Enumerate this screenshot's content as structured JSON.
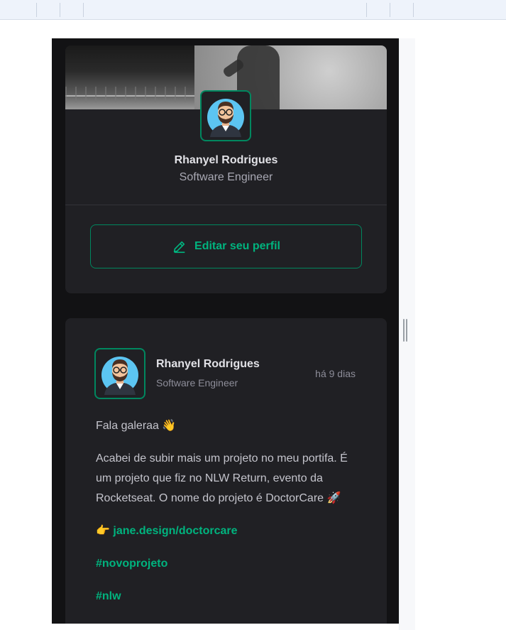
{
  "profile": {
    "name": "Rhanyel Rodrigues",
    "role": "Software Engineer",
    "edit_button_label": "Editar seu perfil"
  },
  "post": {
    "author": {
      "name": "Rhanyel Rodrigues",
      "role": "Software Engineer"
    },
    "published_relative": "há 9 dias",
    "greeting": "Fala galeraa 👋",
    "body": "Acabei de subir mais um projeto no meu portifa. É um projeto que fiz no NLW Return, evento da Rocketseat. O nome do projeto é DoctorCare 🚀",
    "link_prefix": "👉 ",
    "link_text": "jane.design/doctorcare",
    "hashtags": [
      "#novoprojeto",
      "#nlw"
    ]
  },
  "colors": {
    "accent": "#00b37e",
    "accent_border": "#00875f",
    "card_bg": "#202024",
    "page_bg": "#121214"
  }
}
